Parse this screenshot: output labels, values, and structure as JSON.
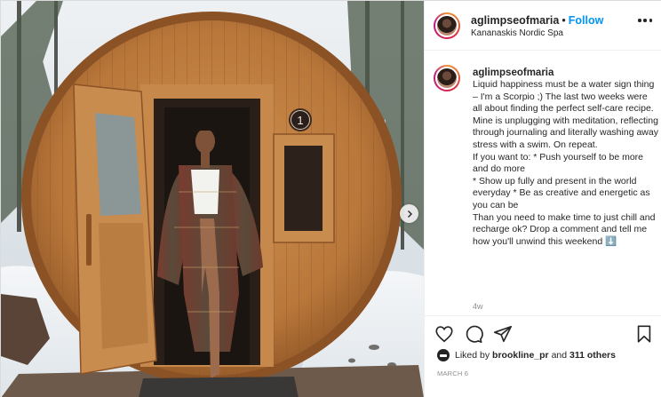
{
  "header": {
    "username": "aglimpseofmaria",
    "separator": "•",
    "follow_label": "Follow",
    "location": "Kananaskis Nordic Spa"
  },
  "caption": {
    "username": "aglimpseofmaria",
    "text": "Liquid happiness must be a water sign thing – I'm a Scorpio ;) The last two weeks were all about finding the perfect self-care recipe. Mine is unplugging with meditation, reflecting through journaling and literally washing away stress with a swim. On repeat.\nIf you want to: * Push yourself to be more and do more\n* Show up fully and present in the world everyday * Be as creative and energetic as you can be\nThan you need to make time to just chill and recharge ok? Drop a comment and tell me how you'll unwind this weekend ⬇️",
    "time": "4w"
  },
  "likes": {
    "prefix": "Liked by",
    "user": "brookline_pr",
    "middle": "and",
    "count_text": "311 others"
  },
  "date": "MARCH 6",
  "photo": {
    "door_number": "1"
  },
  "icons": {
    "like": "heart-icon",
    "comment": "comment-icon",
    "share": "share-icon",
    "save": "bookmark-icon",
    "more": "more-options-icon",
    "next": "chevron-right-icon"
  }
}
